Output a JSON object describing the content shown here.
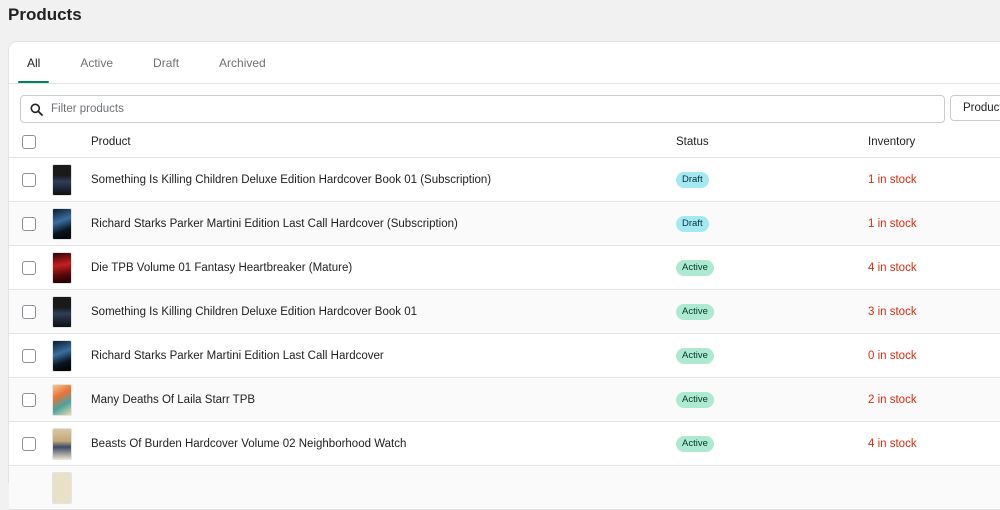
{
  "page": {
    "title": "Products"
  },
  "tabs": [
    {
      "label": "All",
      "selected": true
    },
    {
      "label": "Active",
      "selected": false
    },
    {
      "label": "Draft",
      "selected": false
    },
    {
      "label": "Archived",
      "selected": false
    }
  ],
  "filter": {
    "placeholder": "Filter products",
    "icon": "search-icon"
  },
  "product_type_button": {
    "label": "Product"
  },
  "table": {
    "columns": {
      "product": "Product",
      "status": "Status",
      "inventory": "Inventory"
    },
    "rows": [
      {
        "title": "Something Is Killing Children Deluxe Edition Hardcover Book 01 (Subscription)",
        "status": "Draft",
        "inventory": "1 in stock"
      },
      {
        "title": "Richard Starks Parker Martini Edition Last Call Hardcover (Subscription)",
        "status": "Draft",
        "inventory": "1 in stock"
      },
      {
        "title": "Die TPB Volume 01 Fantasy Heartbreaker (Mature)",
        "status": "Active",
        "inventory": "4 in stock"
      },
      {
        "title": "Something Is Killing Children Deluxe Edition Hardcover Book 01",
        "status": "Active",
        "inventory": "3 in stock"
      },
      {
        "title": "Richard Starks Parker Martini Edition Last Call Hardcover",
        "status": "Active",
        "inventory": "0 in stock"
      },
      {
        "title": "Many Deaths Of Laila Starr TPB",
        "status": "Active",
        "inventory": "2 in stock"
      },
      {
        "title": "Beasts Of Burden Hardcover Volume 02 Neighborhood Watch",
        "status": "Active",
        "inventory": "4 in stock"
      }
    ]
  },
  "colors": {
    "accent": "#008060",
    "draft_badge": "#a4e8f2",
    "active_badge": "#aee9d1",
    "inventory_critical": "#d72c0d"
  }
}
